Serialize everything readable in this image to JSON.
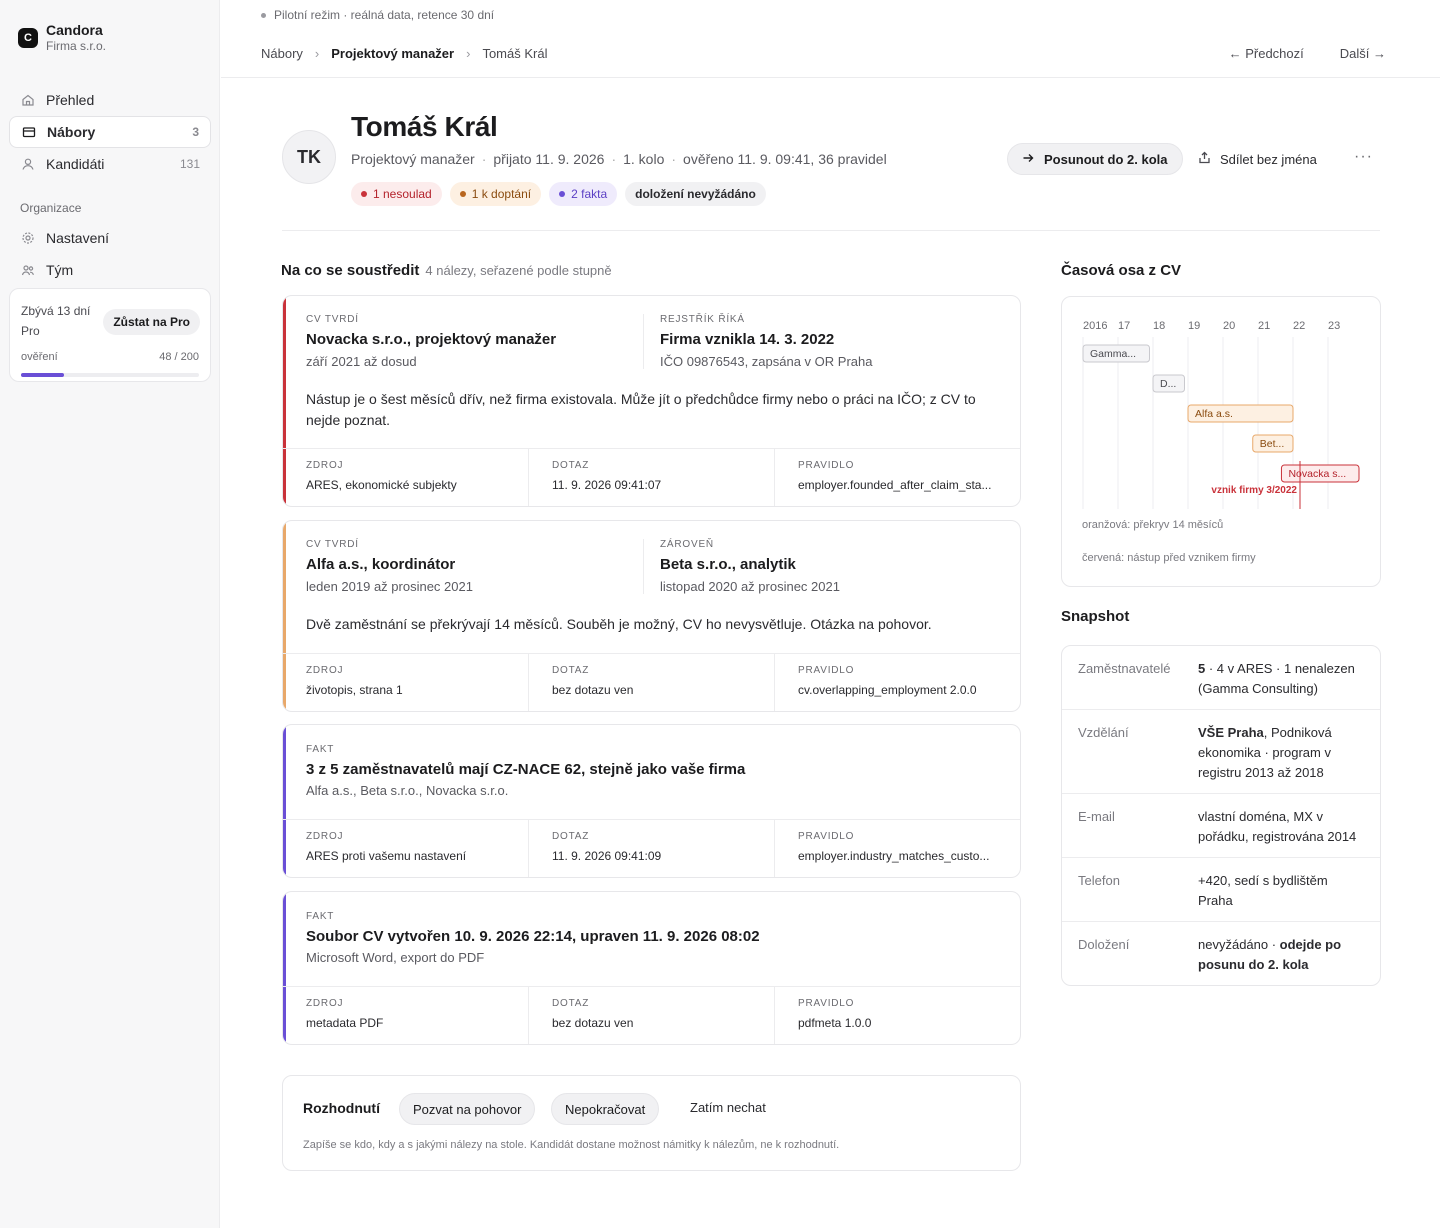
{
  "brand": {
    "logo": "C",
    "name": "Candora",
    "sub": "Firma s.r.o."
  },
  "nav": [
    {
      "label": "Přehled",
      "icon": "home-icon",
      "count": ""
    },
    {
      "label": "Nábory",
      "icon": "briefcase-icon",
      "count": "3",
      "active": true
    },
    {
      "label": "Kandidáti",
      "icon": "person-icon",
      "count": "131"
    }
  ],
  "nav_section": "Organizace",
  "nav2": [
    {
      "label": "Nastavení",
      "icon": "gear-icon"
    },
    {
      "label": "Tým",
      "icon": "team-icon"
    }
  ],
  "promo": {
    "text": "Zbývá 13 dní Pro",
    "button": "Zůstat na Pro",
    "label": "ověření",
    "count": "48 / 200",
    "progress": 0.24
  },
  "pilot": "Pilotní režim · reálná data, retence 30 dní",
  "breadcrumb": [
    "Nábory",
    "Projektový manažer",
    "Tomáš Král"
  ],
  "pager": {
    "prev": "← Předchozí",
    "next": "Další →"
  },
  "candidate": {
    "initials": "TK",
    "name": "Tomáš Král",
    "meta": [
      "Projektový manažer",
      "přijato 11. 9. 2026",
      "1. kolo",
      "ověřeno 11. 9. 09:41, 36 pravidel"
    ],
    "tags": [
      "1 nesoulad",
      "1 k doptání",
      "2 fakta",
      "doložení nevyžádáno"
    ]
  },
  "actions": {
    "primary": "Posunout do 2. kola",
    "share": "Sdílet bez jména",
    "more": "···"
  },
  "focus": {
    "title": "Na co se soustředit",
    "sub": "4 nálezy, seřazené podle stupně"
  },
  "findings": [
    {
      "cols": [
        {
          "kicker": "CV tvrdí",
          "title": "Novacka s.r.o., projektový manažer",
          "sub": "září 2021 až dosud"
        },
        {
          "kicker": "Rejstřík říká",
          "title": "Firma vznikla 14. 3. 2022",
          "sub": "IČO 09876543, zapsána v OR Praha"
        }
      ],
      "body": "Nástup je o šest měsíců dřív, než firma existovala. Může jít o předchůdce firmy nebo o práci na IČO; z CV to nejde poznat.",
      "foot": [
        {
          "label": "Zdroj",
          "value": "ARES, ekonomické subjekty"
        },
        {
          "label": "Dotaz",
          "value": "11. 9. 2026 09:41:07"
        },
        {
          "label": "Pravidlo",
          "value": "employer.founded_after_claim_sta..."
        }
      ]
    },
    {
      "cols": [
        {
          "kicker": "CV tvrdí",
          "title": "Alfa a.s., koordinátor",
          "sub": "leden 2019 až prosinec 2021"
        },
        {
          "kicker": "Zároveň",
          "title": "Beta s.r.o., analytik",
          "sub": "listopad 2020 až prosinec 2021"
        }
      ],
      "body": "Dvě zaměstnání se překrývají 14 měsíců. Souběh je možný, CV ho nevysvětluje. Otázka na pohovor.",
      "foot": [
        {
          "label": "Zdroj",
          "value": "životopis, strana 1"
        },
        {
          "label": "Dotaz",
          "value": "bez dotazu ven"
        },
        {
          "label": "Pravidlo",
          "value": "cv.overlapping_employment 2.0.0"
        }
      ]
    },
    {
      "kicker": "Fakt",
      "title": "3 z 5 zaměstnavatelů mají CZ-NACE 62, stejně jako vaše firma",
      "sub": "Alfa a.s., Beta s.r.o., Novacka s.r.o.",
      "foot": [
        {
          "label": "Zdroj",
          "value": "ARES proti vašemu nastavení"
        },
        {
          "label": "Dotaz",
          "value": "11. 9. 2026 09:41:09"
        },
        {
          "label": "Pravidlo",
          "value": "employer.industry_matches_custo..."
        }
      ]
    },
    {
      "kicker": "Fakt",
      "title": "Soubor CV vytvořen 10. 9. 2026 22:14, upraven 11. 9. 2026 08:02",
      "sub": "Microsoft Word, export do PDF",
      "foot": [
        {
          "label": "Zdroj",
          "value": "metadata PDF"
        },
        {
          "label": "Dotaz",
          "value": "bez dotazu ven"
        },
        {
          "label": "Pravidlo",
          "value": "pdfmeta 1.0.0"
        }
      ]
    }
  ],
  "decision": {
    "title": "Rozhodnutí",
    "invite": "Pozvat na pohovor",
    "reject": "Nepokračovat",
    "keep": "Zatím nechat",
    "note": "Zapíše se kdo, kdy a s jakými nálezy na stole. Kandidát dostane možnost námitky k nálezům, ne k rozhodnutí."
  },
  "timeline": {
    "title": "Časová osa z CV",
    "years": [
      "2016",
      "17",
      "18",
      "19",
      "20",
      "21",
      "22",
      "23"
    ],
    "bars": [
      {
        "label": "Gamma...",
        "start": 2016.0,
        "end": 2017.9,
        "kind": "neutral"
      },
      {
        "label": "D...",
        "start": 2018.0,
        "end": 2018.9,
        "kind": "neutral"
      },
      {
        "label": "Alfa a.s.",
        "start": 2019.0,
        "end": 2022.0,
        "kind": "overlap"
      },
      {
        "label": "Bet...",
        "start": 2020.85,
        "end": 2022.0,
        "kind": "overlap"
      },
      {
        "label": "Novacka s...",
        "start": 2021.67,
        "end": 2024.0,
        "kind": "conflict"
      }
    ],
    "marker": {
      "x": 2022.2,
      "label": "vznik firmy 3/2022"
    },
    "legend": [
      "oranžová: překryv 14 měsíců",
      "červená: nástup před vznikem firmy"
    ],
    "colors": {
      "overlap_fill": "#fdf0e2",
      "overlap_stroke": "#e8a86a",
      "conflict_fill": "#fdecec",
      "conflict_stroke": "#c9323a",
      "neutral_fill": "#f4f4f6",
      "neutral_stroke": "#c9c9ce"
    }
  },
  "snapshot": {
    "title": "Snapshot",
    "rows": [
      {
        "label": "Zaměstnavatelé",
        "bold": "5",
        "rest": " · 4 v ARES · 1 nenalezen (Gamma Consulting)"
      },
      {
        "label": "Vzdělání",
        "bold": "VŠE Praha",
        "rest": ", Podniková ekonomika · program v registru 2013 až 2018"
      },
      {
        "label": "E-mail",
        "bold": "",
        "rest": "vlastní doména, MX v pořádku, registrována 2014"
      },
      {
        "label": "Telefon",
        "bold": "",
        "rest": "+420, sedí s bydlištěm Praha"
      },
      {
        "label": "Doložení",
        "bold": "",
        "rest": "nevyžádáno · ",
        "bold2": "odejde po posunu do 2. kola"
      }
    ]
  },
  "colors": {
    "red": "#c9323a",
    "orange": "#e8a86a",
    "purple": "#6a4fd6",
    "accent": "#6a4fd6"
  }
}
